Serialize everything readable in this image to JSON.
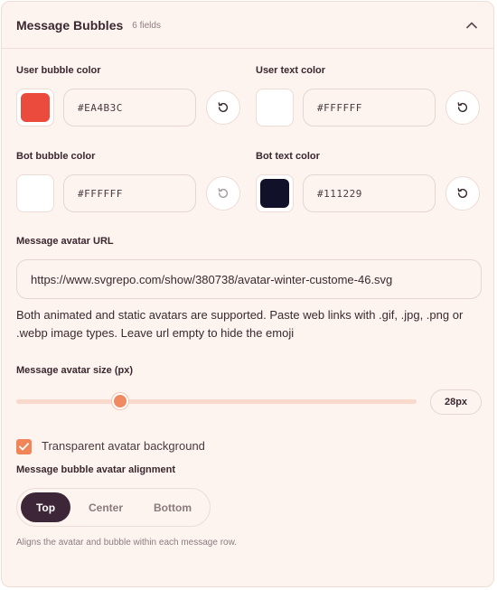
{
  "section": {
    "title": "Message Bubbles",
    "field_count": "6 fields"
  },
  "colors": {
    "user_bubble": {
      "label": "User bubble color",
      "value": "#EA4B3C",
      "swatch": "#EA4B3C"
    },
    "user_text": {
      "label": "User text color",
      "value": "#FFFFFF",
      "swatch": "#FFFFFF"
    },
    "bot_bubble": {
      "label": "Bot bubble color",
      "value": "#FFFFFF",
      "swatch": "#FFFFFF"
    },
    "bot_text": {
      "label": "Bot text color",
      "value": "#111229",
      "swatch": "#111229"
    }
  },
  "avatar_url": {
    "label": "Message avatar URL",
    "value": "https://www.svgrepo.com/show/380738/avatar-winter-custome-46.svg",
    "help": "Both animated and static avatars are supported. Paste web links with .gif, .jpg, .png or .webp image types. Leave url empty to hide the emoji"
  },
  "avatar_size": {
    "label": "Message avatar size (px)",
    "value_label": "28px",
    "level": 0.26
  },
  "transparent_bg": {
    "label": "Transparent avatar background",
    "checked": true
  },
  "alignment": {
    "label": "Message bubble avatar alignment",
    "options": [
      "Top",
      "Center",
      "Bottom"
    ],
    "selected": "Top",
    "help": "Aligns the avatar and bubble within each message row."
  },
  "theme": {
    "accent": "#F0855A",
    "active_segment": "#3D2637"
  },
  "icons": {
    "collapse": "chevron-up-icon",
    "reset": "reset-icon",
    "checkbox": "check-icon"
  }
}
